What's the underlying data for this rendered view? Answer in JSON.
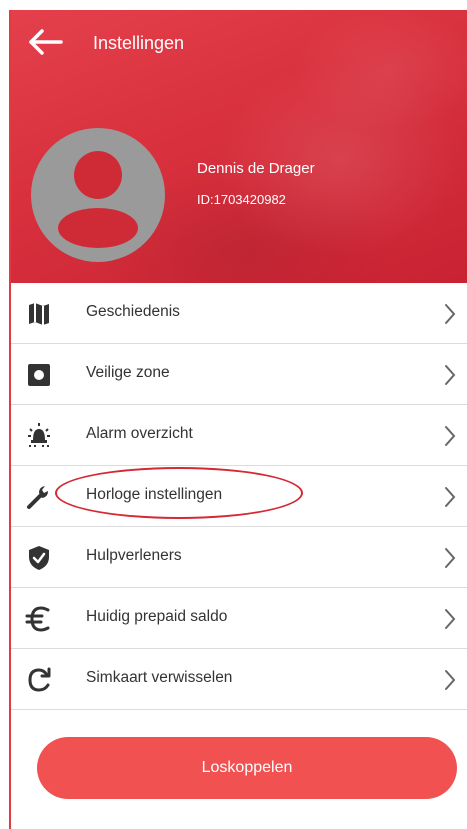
{
  "header": {
    "title": "Instellingen",
    "user": {
      "name": "Dennis de Drager",
      "id": "ID:1703420982"
    }
  },
  "menu": {
    "items": [
      {
        "label": "Geschiedenis",
        "icon": "map-icon"
      },
      {
        "label": "Veilige zone",
        "icon": "safe-zone-icon"
      },
      {
        "label": "Alarm overzicht",
        "icon": "alarm-light-icon"
      },
      {
        "label": "Horloge instellingen",
        "icon": "wrench-icon"
      },
      {
        "label": "Hulpverleners",
        "icon": "shield-check-icon"
      },
      {
        "label": "Huidig prepaid saldo",
        "icon": "euro-icon"
      },
      {
        "label": "Simkaart verwisselen",
        "icon": "refresh-icon"
      }
    ]
  },
  "actions": {
    "logout_label": "Loskoppelen"
  },
  "colors": {
    "accent": "#e4404c",
    "button": "#f25151",
    "annotation": "#d42a35",
    "icon": "#333333"
  }
}
